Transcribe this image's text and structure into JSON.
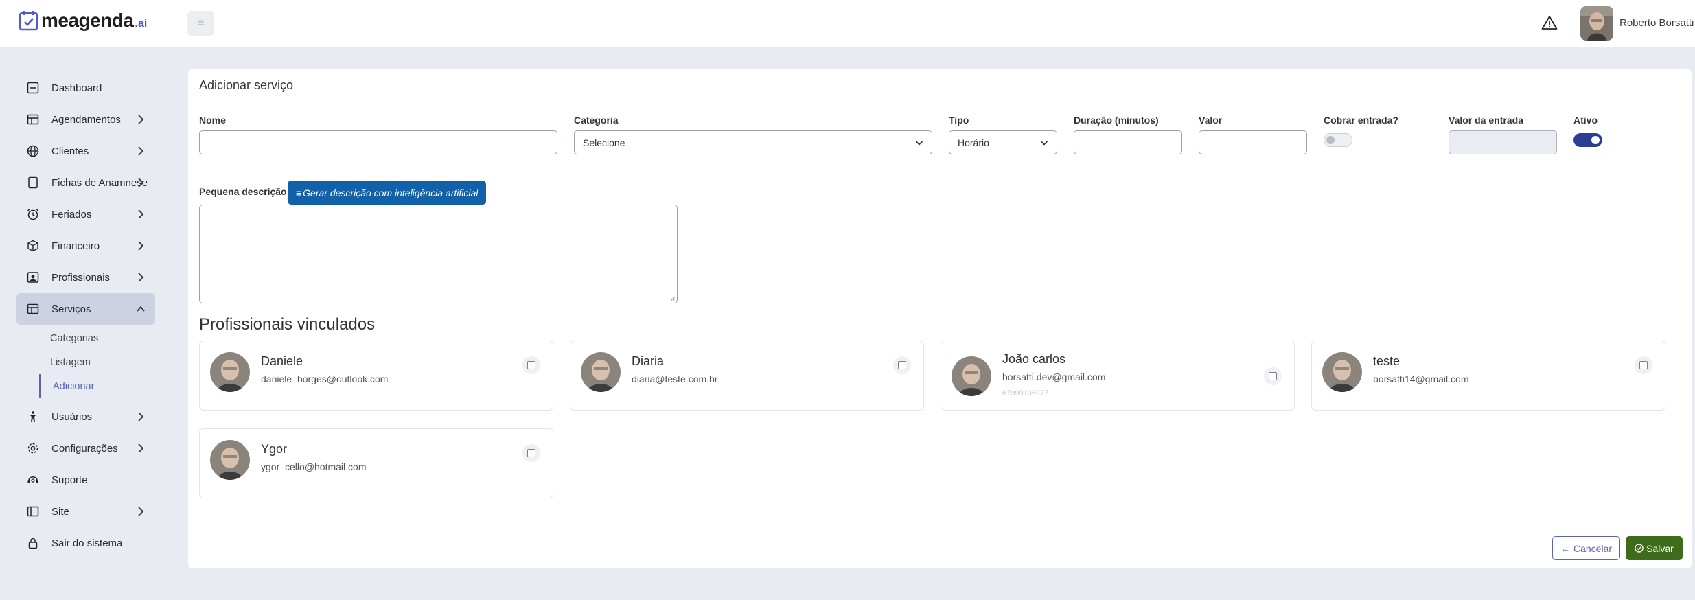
{
  "header": {
    "logo_text": "meagenda",
    "logo_suffix": ".ai",
    "menu_toggle_glyph": "≡",
    "alert_icon": "warning-triangle-icon",
    "user_name": "Roberto Borsatti"
  },
  "sidebar": {
    "items": [
      {
        "label": "Dashboard",
        "icon": "dashboard-icon",
        "has_chevron": false
      },
      {
        "label": "Agendamentos",
        "icon": "calendar-icon",
        "has_chevron": true
      },
      {
        "label": "Clientes",
        "icon": "globe-icon",
        "has_chevron": true
      },
      {
        "label": "Fichas de Anamnese",
        "icon": "file-icon",
        "has_chevron": true
      },
      {
        "label": "Feriados",
        "icon": "alarm-clock-icon",
        "has_chevron": true
      },
      {
        "label": "Financeiro",
        "icon": "box-icon",
        "has_chevron": true
      },
      {
        "label": "Profissionais",
        "icon": "id-card-icon",
        "has_chevron": true
      },
      {
        "label": "Serviços",
        "icon": "layout-icon",
        "has_chevron": true,
        "expanded": true
      },
      {
        "label": "Usuários",
        "icon": "person-icon",
        "has_chevron": true
      },
      {
        "label": "Configurações",
        "icon": "gear-icon",
        "has_chevron": true
      },
      {
        "label": "Suporte",
        "icon": "headset-icon",
        "has_chevron": false
      },
      {
        "label": "Site",
        "icon": "sidebar-layout-icon",
        "has_chevron": true
      },
      {
        "label": "Sair do sistema",
        "icon": "lock-icon",
        "has_chevron": false
      }
    ],
    "servicos_submenu": [
      {
        "label": "Categorias"
      },
      {
        "label": "Listagem"
      },
      {
        "label": "Adicionar",
        "current": true
      }
    ]
  },
  "form": {
    "title": "Adicionar serviço",
    "nome_label": "Nome",
    "nome_value": "",
    "categoria_label": "Categoria",
    "categoria_value": "Selecione",
    "tipo_label": "Tipo",
    "tipo_value": "Horário",
    "duracao_label": "Duração (minutos)",
    "duracao_value": "",
    "valor_label": "Valor",
    "valor_value": "",
    "cobrar_label": "Cobrar entrada?",
    "cobrar_on": false,
    "valor_entrada_label": "Valor da entrada",
    "valor_entrada_value": "",
    "ativo_label": "Ativo",
    "ativo_on": true,
    "descricao_label": "Pequena descrição",
    "ai_button_icon": "≡",
    "ai_button_label": "Gerar descrição com inteligência artificial",
    "descricao_value": ""
  },
  "profissionais": {
    "title": "Profissionais vinculados",
    "items": [
      {
        "name": "Daniele",
        "email": "daniele_borges@outlook.com",
        "phone": "",
        "checked": false
      },
      {
        "name": "Diaria",
        "email": "diaria@teste.com.br",
        "phone": "",
        "checked": false
      },
      {
        "name": "João carlos",
        "email": "borsatti.dev@gmail.com",
        "phone": "67999106277",
        "checked": false
      },
      {
        "name": "teste",
        "email": "borsatti14@gmail.com",
        "phone": "",
        "checked": false
      },
      {
        "name": "Ygor",
        "email": "ygor_cello@hotmail.com",
        "phone": "",
        "checked": false
      }
    ]
  },
  "actions": {
    "cancel_label": "Cancelar",
    "cancel_icon": "arrow-left-icon",
    "save_label": "Salvar",
    "save_icon": "check-circle-icon"
  },
  "colors": {
    "primary": "#5a64b7",
    "ai_button": "#1261a8",
    "toggle_on": "#2c3e94",
    "save_button": "#3f6b1c",
    "background": "#e9ebf3"
  }
}
